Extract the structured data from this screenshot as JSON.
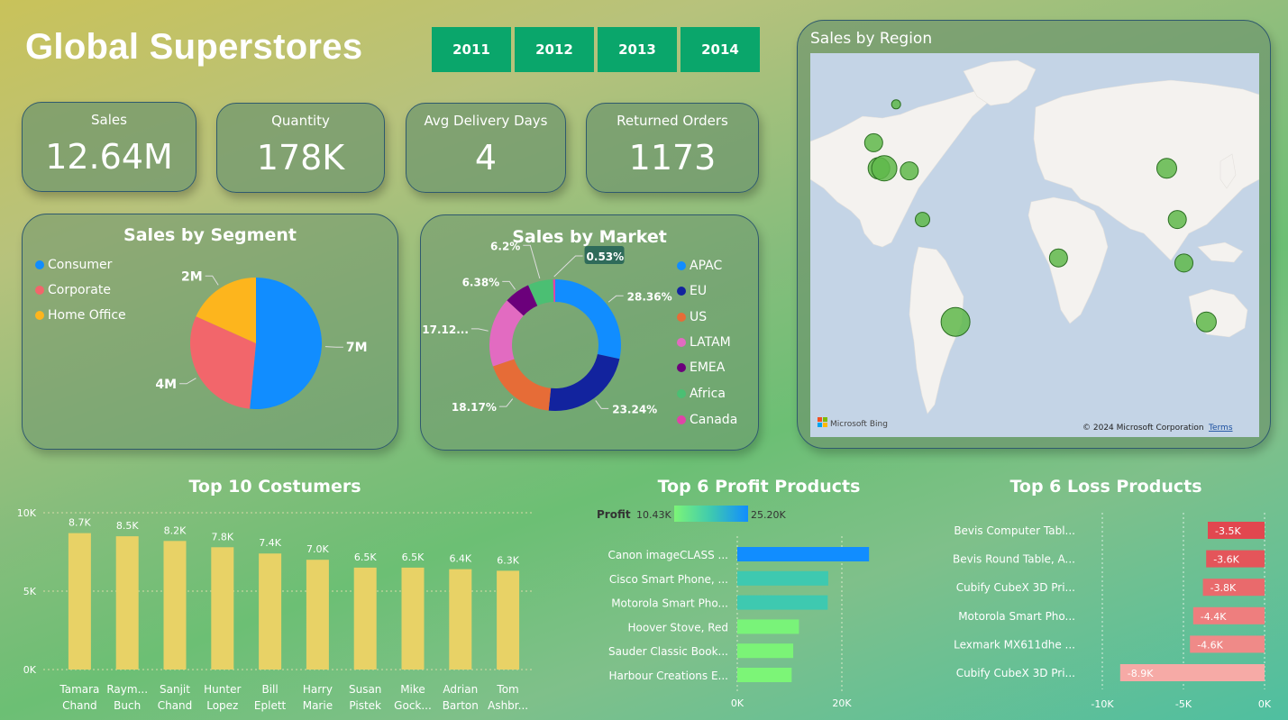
{
  "header": {
    "title": "Global Superstores",
    "years": [
      "2011",
      "2012",
      "2013",
      "2014"
    ]
  },
  "kpis": [
    {
      "label": "Sales",
      "value": "12.64M"
    },
    {
      "label": "Quantity",
      "value": "178K"
    },
    {
      "label": "Avg Delivery Days",
      "value": "4"
    },
    {
      "label": "Returned Orders",
      "value": "1173"
    }
  ],
  "segment": {
    "title": "Sales by Segment",
    "legend": [
      {
        "name": "Consumer",
        "color": "#118dff"
      },
      {
        "name": "Corporate",
        "color": "#f2666b"
      },
      {
        "name": "Home Office",
        "color": "#fdb51d"
      }
    ]
  },
  "market": {
    "title": "Sales by Market",
    "legend": [
      {
        "name": "APAC",
        "color": "#118dff"
      },
      {
        "name": "EU",
        "color": "#12239e"
      },
      {
        "name": "US",
        "color": "#e66c37"
      },
      {
        "name": "LATAM",
        "color": "#e26bc1"
      },
      {
        "name": "EMEA",
        "color": "#6b007b"
      },
      {
        "name": "Africa",
        "color": "#4bbf73"
      },
      {
        "name": "Canada",
        "color": "#e044a7"
      }
    ]
  },
  "region": {
    "title": "Sales by Region",
    "bing_label": "Microsoft Bing",
    "copyright": "© 2024 Microsoft Corporation",
    "terms": "Terms"
  },
  "customers": {
    "title": "Top 10 Costumers"
  },
  "profit": {
    "title": "Top 6 Profit Products",
    "legend_label": "Profit",
    "legend_min": "10.43K",
    "legend_max": "25.20K"
  },
  "loss": {
    "title": "Top 6 Loss Products"
  },
  "chart_data": [
    {
      "type": "pie",
      "title": "Sales by Segment",
      "categories": [
        "Consumer",
        "Corporate",
        "Home Office"
      ],
      "values": [
        6.51,
        3.82,
        2.31
      ],
      "data_labels": [
        "7M",
        "4M",
        "2M"
      ]
    },
    {
      "type": "pie",
      "title": "Sales by Market",
      "categories": [
        "APAC",
        "EU",
        "US",
        "LATAM",
        "EMEA",
        "Africa",
        "Canada"
      ],
      "values": [
        28.36,
        23.24,
        18.17,
        17.12,
        6.38,
        6.2,
        0.53
      ],
      "data_labels": [
        "28.36%",
        "23.24%",
        "18.17%",
        "17.12...",
        "6.38%",
        "6.2%",
        "0.53%"
      ]
    },
    {
      "type": "bar",
      "title": "Top 10 Costumers",
      "categories": [
        "Tamara Chand",
        "Raym... Buch",
        "Sanjit Chand",
        "Hunter Lopez",
        "Bill Eplett",
        "Harry Marie",
        "Susan Pistek",
        "Mike Gock...",
        "Adrian Barton",
        "Tom Ashbr..."
      ],
      "values": [
        8.7,
        8.5,
        8.2,
        7.8,
        7.4,
        7.0,
        6.5,
        6.5,
        6.4,
        6.3
      ],
      "data_labels": [
        "8.7K",
        "8.5K",
        "8.2K",
        "7.8K",
        "7.4K",
        "7.0K",
        "6.5K",
        "6.5K",
        "6.4K",
        "6.3K"
      ],
      "ylim": [
        0,
        10
      ],
      "yticks": [
        "0K",
        "5K",
        "10K"
      ]
    },
    {
      "type": "bar",
      "title": "Top 6 Profit Products",
      "categories": [
        "Canon imageCLASS ...",
        "Cisco Smart Phone, ...",
        "Motorola Smart Pho...",
        "Hoover Stove, Red",
        "Sauder Classic Book...",
        "Harbour Creations E..."
      ],
      "values": [
        25.2,
        17.4,
        17.3,
        11.8,
        10.7,
        10.4
      ],
      "xlim": [
        0,
        30
      ],
      "xticks": [
        "0K",
        "20K"
      ]
    },
    {
      "type": "bar",
      "title": "Top 6 Loss Products",
      "categories": [
        "Bevis Computer Tabl...",
        "Bevis Round Table, A...",
        "Cubify CubeX 3D Pri...",
        "Motorola Smart Pho...",
        "Lexmark MX611dhe ...",
        "Cubify CubeX 3D Pri..."
      ],
      "values": [
        -3.5,
        -3.6,
        -3.8,
        -4.4,
        -4.6,
        -8.9
      ],
      "data_labels": [
        "-3.5K",
        "-3.6K",
        "-3.8K",
        "-4.4K",
        "-4.6K",
        "-8.9K"
      ],
      "xlim": [
        -10,
        0
      ],
      "xticks": [
        "-10K",
        "-5K",
        "0K"
      ]
    }
  ]
}
